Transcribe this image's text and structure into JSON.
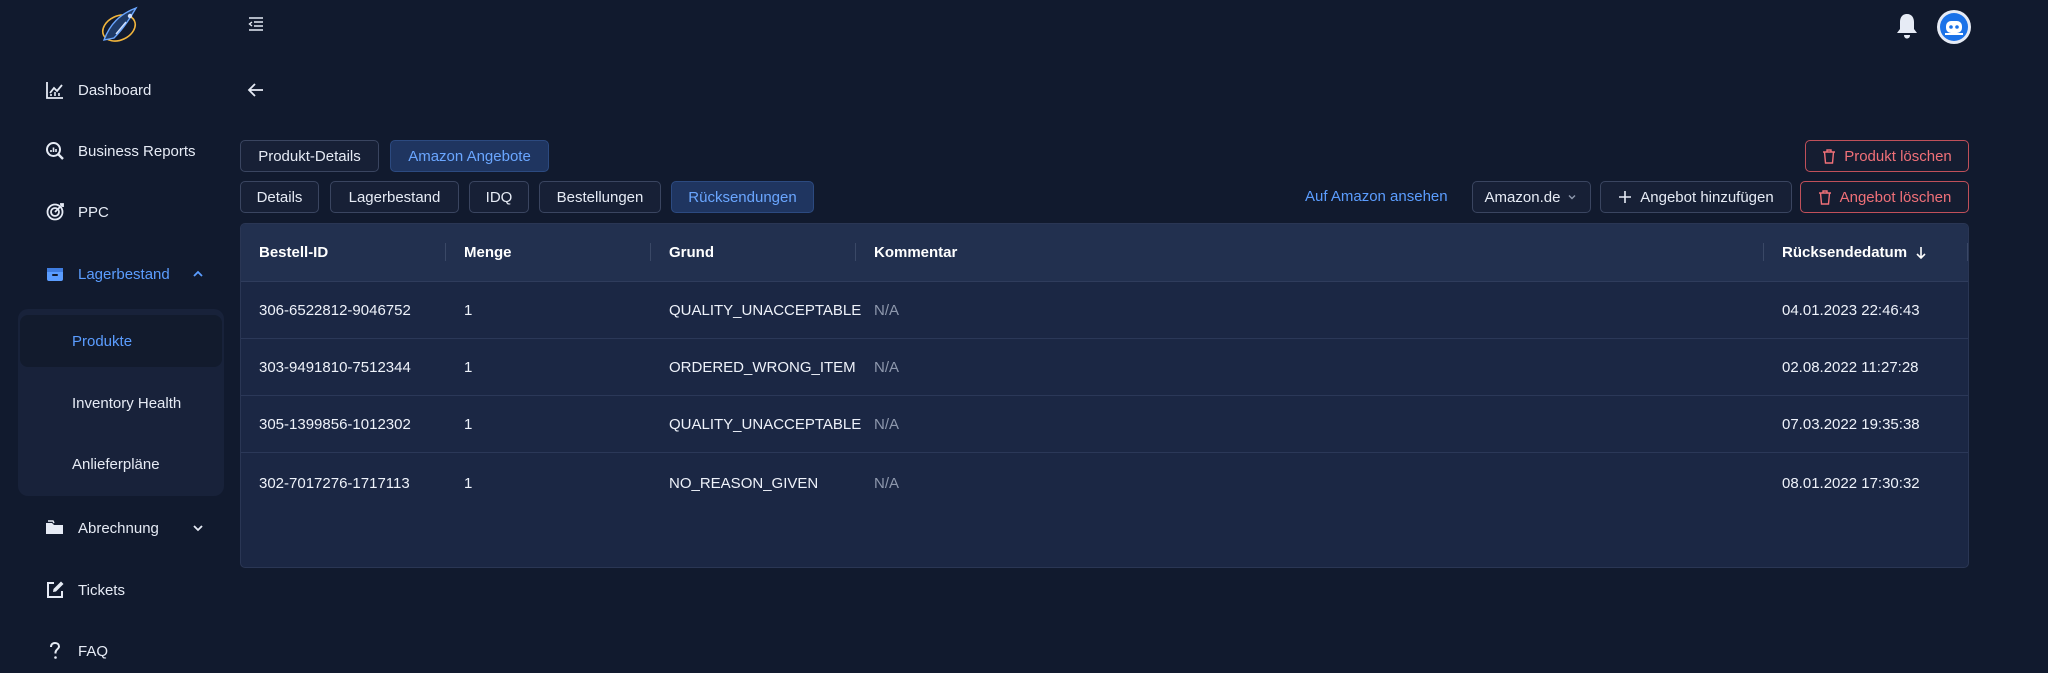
{
  "sidebar": {
    "items": [
      {
        "label": "Dashboard",
        "icon": "chart-line-icon"
      },
      {
        "label": "Business Reports",
        "icon": "search-report-icon"
      },
      {
        "label": "PPC",
        "icon": "target-icon"
      },
      {
        "label": "Lagerbestand",
        "icon": "box-icon"
      },
      {
        "label": "Abrechnung",
        "icon": "folder-icon"
      },
      {
        "label": "Tickets",
        "icon": "edit-icon"
      },
      {
        "label": "FAQ",
        "icon": "question-icon"
      }
    ],
    "subitems": [
      {
        "label": "Produkte"
      },
      {
        "label": "Inventory Health"
      },
      {
        "label": "Anlieferpläne"
      }
    ]
  },
  "tabs_top": {
    "produkt_details": "Produkt-Details",
    "amazon_angebote": "Amazon Angebote"
  },
  "tabs_sub": {
    "details": "Details",
    "lagerbestand": "Lagerbestand",
    "idq": "IDQ",
    "bestellungen": "Bestellungen",
    "ruecksendungen": "Rücksendungen"
  },
  "actions": {
    "produkt_loeschen": "Produkt löschen",
    "auf_amazon": "Auf Amazon ansehen",
    "marketplace": "Amazon.de",
    "angebot_hinzufuegen": "Angebot hinzufügen",
    "angebot_loeschen": "Angebot löschen"
  },
  "table": {
    "headers": [
      "Bestell-ID",
      "Menge",
      "Grund",
      "Kommentar",
      "Rücksendedatum"
    ],
    "rows": [
      [
        "306-6522812-9046752",
        "1",
        "QUALITY_UNACCEPTABLE",
        "N/A",
        "04.01.2023 22:46:43"
      ],
      [
        "303-9491810-7512344",
        "1",
        "ORDERED_WRONG_ITEM",
        "N/A",
        "02.08.2022 11:27:28"
      ],
      [
        "305-1399856-1012302",
        "1",
        "QUALITY_UNACCEPTABLE",
        "N/A",
        "07.03.2022 19:35:38"
      ],
      [
        "302-7017276-1717113",
        "1",
        "NO_REASON_GIVEN",
        "N/A",
        "08.01.2022 17:30:32"
      ]
    ]
  },
  "colors": {
    "background": "#111a2e",
    "accent": "#5b9dff",
    "danger": "#f07078",
    "table_bg": "#1b2744"
  }
}
